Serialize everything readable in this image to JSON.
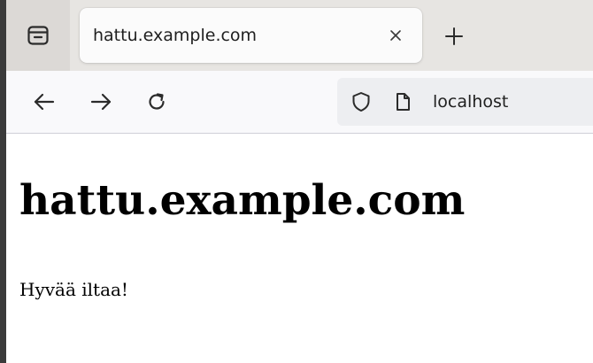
{
  "browser": {
    "tab": {
      "title": "hattu.example.com"
    },
    "url_bar": {
      "url": "localhost"
    },
    "icons": {
      "tab_overview": "tab-overview-icon",
      "close": "close-icon",
      "new_tab": "plus-icon",
      "back": "arrow-left-icon",
      "forward": "arrow-right-icon",
      "reload": "reload-icon",
      "shield": "shield-icon",
      "page": "page-icon"
    }
  },
  "page": {
    "heading": "hattu.example.com",
    "paragraph": "Hyvää iltaa!"
  },
  "colors": {
    "tabbar_bg": "#e7e5e2",
    "navbar_bg": "#f9f9fb",
    "urlbar_bg": "#edeef1",
    "frame": "#3b3b3b"
  }
}
